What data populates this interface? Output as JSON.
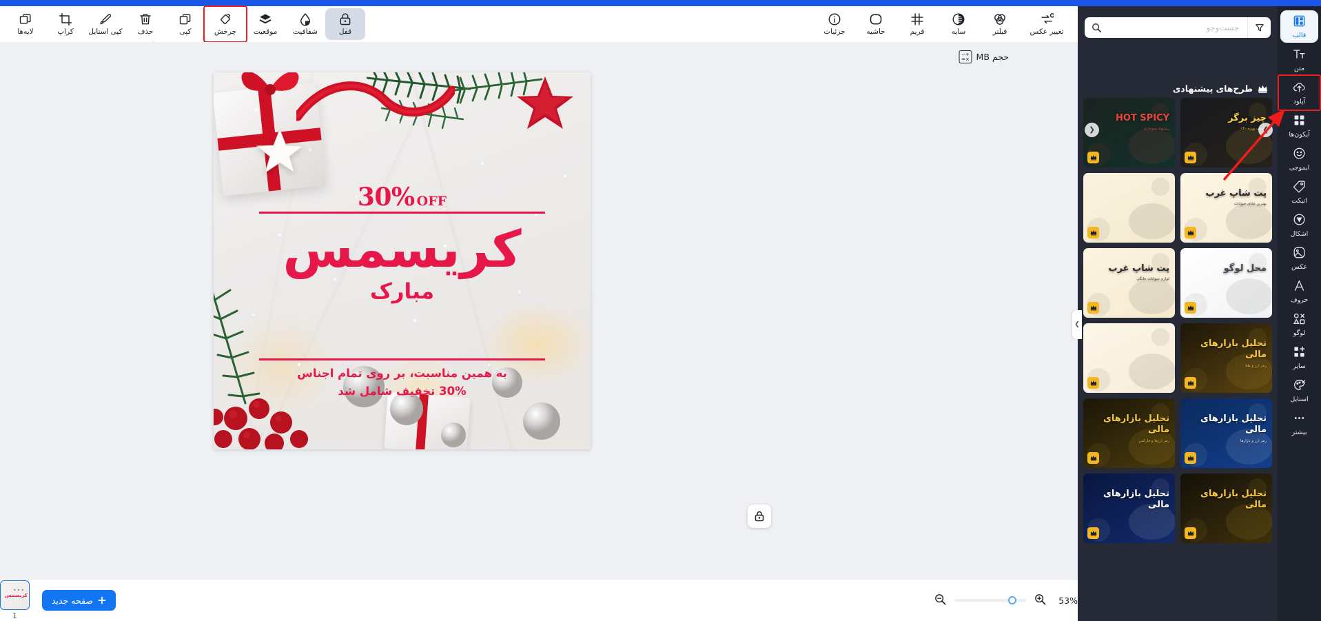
{
  "toolbar": {
    "items": [
      {
        "label": "لایه‌ها",
        "icon": "layers-icon",
        "state": "normal"
      },
      {
        "label": "کراپ",
        "icon": "crop-icon",
        "state": "normal"
      },
      {
        "label": "کپی استایل",
        "icon": "brush-icon",
        "state": "normal"
      },
      {
        "label": "حذف",
        "icon": "trash-icon",
        "state": "normal"
      },
      {
        "label": "کپی",
        "icon": "duplicate-icon",
        "state": "normal"
      },
      {
        "label": "چرخش",
        "icon": "rotate-icon",
        "state": "highlighted"
      },
      {
        "label": "موقعیت",
        "icon": "position-icon",
        "state": "normal"
      },
      {
        "label": "شفافیت",
        "icon": "opacity-icon",
        "state": "normal"
      },
      {
        "label": "قفل",
        "icon": "lock-icon",
        "state": "active"
      }
    ],
    "right_items": [
      {
        "label": "جزئیات",
        "icon": "info-icon"
      },
      {
        "label": "حاشیه",
        "icon": "border-icon"
      },
      {
        "label": "فریم",
        "icon": "frame-icon"
      },
      {
        "label": "سایه",
        "icon": "shadow-icon"
      },
      {
        "label": "فیلتر",
        "icon": "filter-circles-icon"
      },
      {
        "label": "تغییر عکس",
        "icon": "swap-image-icon"
      }
    ]
  },
  "canvas": {
    "size_chip": "حجم MB",
    "size_chip_icon": "calculator-icon",
    "lock_badge_icon": "lock-icon",
    "scroll_down_icon": "chevron-down-icon",
    "artboard": {
      "discount_number": "30%",
      "discount_off": "OFF",
      "headline": "کریسمس",
      "subhead": "مبارک",
      "body_line1": "به همین مناسبت، بر روی تمام اجناس",
      "body_line2": "30% تخفیف شامل شد",
      "accent_color": "#e6184a"
    }
  },
  "bottombar": {
    "zoom_percent": "53%",
    "zoom_in_icon": "zoom-in-icon",
    "zoom_out_icon": "zoom-out-icon",
    "new_page_label": "صفحه جدید",
    "new_page_icon": "plus-icon",
    "page_number": "1",
    "page_thumb_title": "کریسمس"
  },
  "panel": {
    "search_placeholder": "جست‌وجو",
    "search_value": "",
    "search_icon": "search-icon",
    "filter_icon": "filter-funnel-icon",
    "section_title": "طرح‌های پیشنهادی",
    "section_icon": "crown-icon",
    "carousel_prev_icon": "chevron-left-icon",
    "carousel_next_icon": "chevron-right-icon",
    "collapse_handle_icon": "chevron-right-icon",
    "templates": [
      {
        "title": "چیز برگر",
        "sub": "تخفیف ویژه ۴۰٪",
        "theme": "burger",
        "premium": true
      },
      {
        "title": "HOT SPICY",
        "sub": "پیشنهاد سوخاری",
        "theme": "spicy",
        "premium": true
      },
      {
        "title": "پت شاپ غرب",
        "sub": "بهترین غذای حیوانات",
        "theme": "petshop-blue",
        "premium": true
      },
      {
        "title": "",
        "sub": "",
        "theme": "dog-cream",
        "premium": true
      },
      {
        "title": "محل لوگو",
        "sub": "",
        "theme": "frame-white",
        "premium": true
      },
      {
        "title": "پت شاپ غرب",
        "sub": "لوازم حیوانات خانگی",
        "theme": "petshop-yellow",
        "premium": true
      },
      {
        "title": "تحلیل\nبازارهای مالی",
        "sub": "رمز ارز و طلا",
        "theme": "gold-bitcoin",
        "premium": true
      },
      {
        "title": "",
        "sub": "",
        "theme": "dog-yellow",
        "premium": true
      },
      {
        "title": "تحلیل\nبازارهای مالی",
        "sub": "رمز ارز و بازارها",
        "theme": "blue-finance",
        "premium": true
      },
      {
        "title": "تحلیل\nبازارهای مالی",
        "sub": "رمز ارزها و فارکس",
        "theme": "gold-finance",
        "premium": true
      },
      {
        "title": "تحلیل بازارهای مالی",
        "sub": "",
        "theme": "dark-gold",
        "premium": true
      },
      {
        "title": "تحلیل\nبازارهای مالی",
        "sub": "",
        "theme": "navy-finance",
        "premium": true
      }
    ]
  },
  "rail": {
    "items": [
      {
        "label": "قالب",
        "icon": "template-icon",
        "state": "active"
      },
      {
        "label": "متن",
        "icon": "text-icon",
        "state": "normal"
      },
      {
        "label": "آپلود",
        "icon": "upload-cloud-icon",
        "state": "highlighted"
      },
      {
        "label": "آیکون‌ها",
        "icon": "grid-squares-icon",
        "state": "normal"
      },
      {
        "label": "ایموجی",
        "icon": "smiley-icon",
        "state": "normal"
      },
      {
        "label": "اتیکت",
        "icon": "tag-icon",
        "state": "normal"
      },
      {
        "label": "اشکال",
        "icon": "shapes-icon",
        "state": "normal"
      },
      {
        "label": "عکس",
        "icon": "image-icon",
        "state": "normal"
      },
      {
        "label": "حروف",
        "icon": "letter-a-icon",
        "state": "normal"
      },
      {
        "label": "لوگو",
        "icon": "logo-shapes-icon",
        "state": "normal"
      },
      {
        "label": "سایر",
        "icon": "grid-plus-icon",
        "state": "normal"
      },
      {
        "label": "استایل",
        "icon": "palette-icon",
        "state": "normal"
      },
      {
        "label": "بیشتر",
        "icon": "ellipsis-icon",
        "state": "normal"
      }
    ]
  },
  "annotations": {
    "arrow_color": "#f01c1c",
    "arrow_to_rotate": "vertical-arrow-up",
    "arrow_to_upload": "diagonal-arrow-up-right"
  }
}
